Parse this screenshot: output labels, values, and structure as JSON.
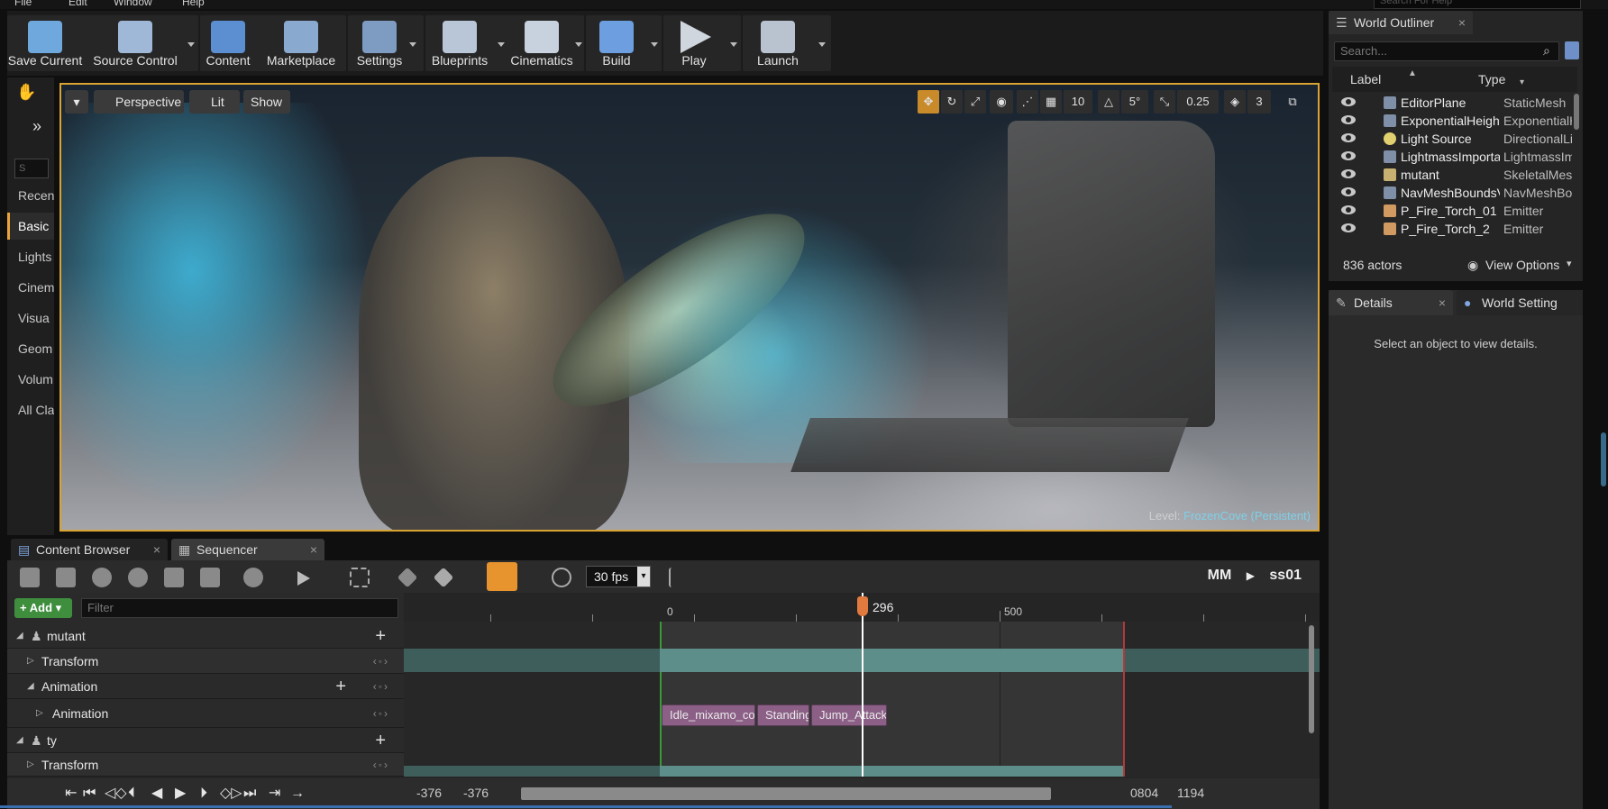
{
  "menu": [
    "File",
    "Edit",
    "Window",
    "Help"
  ],
  "help_search_placeholder": "Search For Help",
  "toolbar": [
    {
      "label": "Save Current",
      "icon": "save-icon",
      "color": "#6fa8dc"
    },
    {
      "label": "Source Control",
      "icon": "source-control-icon",
      "color": "#9fb8d8"
    },
    {
      "label": "Content",
      "icon": "content-icon",
      "color": "#5b8fd1"
    },
    {
      "label": "Marketplace",
      "icon": "marketplace-icon",
      "color": "#8aa9cf"
    },
    {
      "label": "Settings",
      "icon": "settings-icon",
      "color": "#7e9bc2"
    },
    {
      "label": "Blueprints",
      "icon": "blueprints-icon",
      "color": "#b8c6d8"
    },
    {
      "label": "Cinematics",
      "icon": "cinematics-icon",
      "color": "#c8d2de"
    },
    {
      "label": "Build",
      "icon": "build-icon",
      "color": "#6d9ee0"
    },
    {
      "label": "Play",
      "icon": "play-icon",
      "color": "#d0d6de"
    },
    {
      "label": "Launch",
      "icon": "launch-icon",
      "color": "#b9c3cf"
    }
  ],
  "modes": {
    "search_placeholder": "S",
    "items": [
      "Recen",
      "Basic",
      "Lights",
      "Cinem",
      "Visua",
      "Geom",
      "Volum",
      "All Cla"
    ]
  },
  "viewport": {
    "perspective": "Perspective",
    "lit": "Lit",
    "show": "Show",
    "grid_size": "10",
    "rotation_snap": "5°",
    "scale_snap": "0.25",
    "camera_speed": "3",
    "level_prefix": "Level:",
    "level_name": "FrozenCove (Persistent)"
  },
  "outliner": {
    "tab": "World Outliner",
    "search_placeholder": "Search...",
    "col_label": "Label",
    "col_type": "Type",
    "rows": [
      {
        "label": "EditorPlane",
        "type": "StaticMesh"
      },
      {
        "label": "ExponentialHeightFog",
        "type": "ExponentialHeightFog"
      },
      {
        "label": "Light Source",
        "type": "DirectionalLight"
      },
      {
        "label": "LightmassImportanceVolume",
        "type": "LightmassImportanceVolume"
      },
      {
        "label": "mutant",
        "type": "SkeletalMeshActor"
      },
      {
        "label": "NavMeshBoundsVolume",
        "type": "NavMeshBoundsVolume"
      },
      {
        "label": "P_Fire_Torch_01",
        "type": "Emitter"
      },
      {
        "label": "P_Fire_Torch_2",
        "type": "Emitter"
      }
    ],
    "actor_count": "836 actors",
    "view_options": "View Options"
  },
  "details": {
    "tab": "Details",
    "world_tab": "World Setting",
    "empty_text": "Select an object to view details."
  },
  "bottom_tabs": [
    "Content Browser",
    "Sequencer"
  ],
  "sequencer": {
    "fps": "30 fps",
    "crumb_parent": "MM",
    "crumb_child": "ss01",
    "add_label": "Add",
    "filter_placeholder": "Filter",
    "tracks": [
      {
        "label": "mutant",
        "level": 0
      },
      {
        "label": "Transform",
        "level": 1
      },
      {
        "label": "Animation",
        "level": 1
      },
      {
        "label": "Animation",
        "level": 2
      },
      {
        "label": "ty",
        "level": 0
      },
      {
        "label": "Transform",
        "level": 1
      }
    ],
    "ruler_labels": {
      "start": "0",
      "mid": "500"
    },
    "playhead_frame": "296",
    "sections": [
      "Idle_mixamo_com",
      "Standing",
      "Jump_Attack_"
    ],
    "range": {
      "view_start": "-376",
      "work_start": "-376",
      "view_end": "0804",
      "work_end": "1194"
    }
  }
}
